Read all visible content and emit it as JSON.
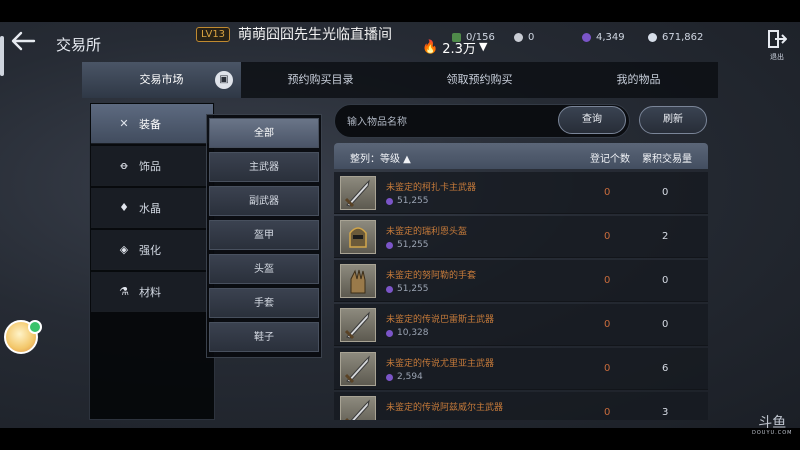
{
  "header": {
    "title": "交易所",
    "streamer_level": "LV13",
    "streamer_name": "萌萌囧囧先生光临直播间",
    "heat": "2.3万"
  },
  "currencies": [
    {
      "name": "green-currency",
      "value": "0/156",
      "color": "#4f8a4a"
    },
    {
      "name": "silver-currency",
      "value": "0",
      "color": "#c9ccd4"
    },
    {
      "name": "purple-currency",
      "value": "4,349",
      "color": "#7b55c8"
    },
    {
      "name": "crystal-currency",
      "value": "671,862",
      "color": "#d6dde8"
    }
  ],
  "exit_label": "退出",
  "tabs": [
    {
      "label": "交易市场",
      "active": true
    },
    {
      "label": "预约购买目录",
      "active": false
    },
    {
      "label": "领取预约购买",
      "active": false
    },
    {
      "label": "我的物品",
      "active": false
    }
  ],
  "categories": [
    {
      "label": "装备",
      "icon": "crossed-swords-icon",
      "active": true
    },
    {
      "label": "饰品",
      "icon": "ring-icon",
      "active": false
    },
    {
      "label": "水晶",
      "icon": "gem-icon",
      "active": false
    },
    {
      "label": "强化",
      "icon": "diamond-icon",
      "active": false
    },
    {
      "label": "材料",
      "icon": "flask-icon",
      "active": false
    }
  ],
  "subcategories": [
    {
      "label": "全部",
      "active": true
    },
    {
      "label": "主武器",
      "active": false
    },
    {
      "label": "副武器",
      "active": false
    },
    {
      "label": "盔甲",
      "active": false
    },
    {
      "label": "头盔",
      "active": false
    },
    {
      "label": "手套",
      "active": false
    },
    {
      "label": "鞋子",
      "active": false
    }
  ],
  "search": {
    "placeholder": "输入物品名称",
    "query_label": "查询",
    "refresh_label": "刷新"
  },
  "list_header": {
    "sort_label": "整列：等级 ▲",
    "registered_label": "登记个数",
    "volume_label": "累积交易量"
  },
  "items": [
    {
      "name": "未鉴定的柯扎卡主武器",
      "price": "51,255",
      "registered": "0",
      "volume": "0",
      "icon": "sword-icon"
    },
    {
      "name": "未鉴定的瑞利恩头盔",
      "price": "51,255",
      "registered": "0",
      "volume": "2",
      "icon": "helmet-icon"
    },
    {
      "name": "未鉴定的努阿勒的手套",
      "price": "51,255",
      "registered": "0",
      "volume": "0",
      "icon": "gauntlet-icon"
    },
    {
      "name": "未鉴定的传说巴雷斯主武器",
      "price": "10,328",
      "registered": "0",
      "volume": "0",
      "icon": "sword-icon"
    },
    {
      "name": "未鉴定的传说尤里亚主武器",
      "price": "2,594",
      "registered": "0",
      "volume": "6",
      "icon": "sword-icon"
    },
    {
      "name": "未鉴定的传说阿兹威尔主武器",
      "price": "",
      "registered": "0",
      "volume": "3",
      "icon": "sword-icon"
    }
  ],
  "watermark": {
    "big": "斗鱼",
    "small": "DOUYU.COM"
  }
}
